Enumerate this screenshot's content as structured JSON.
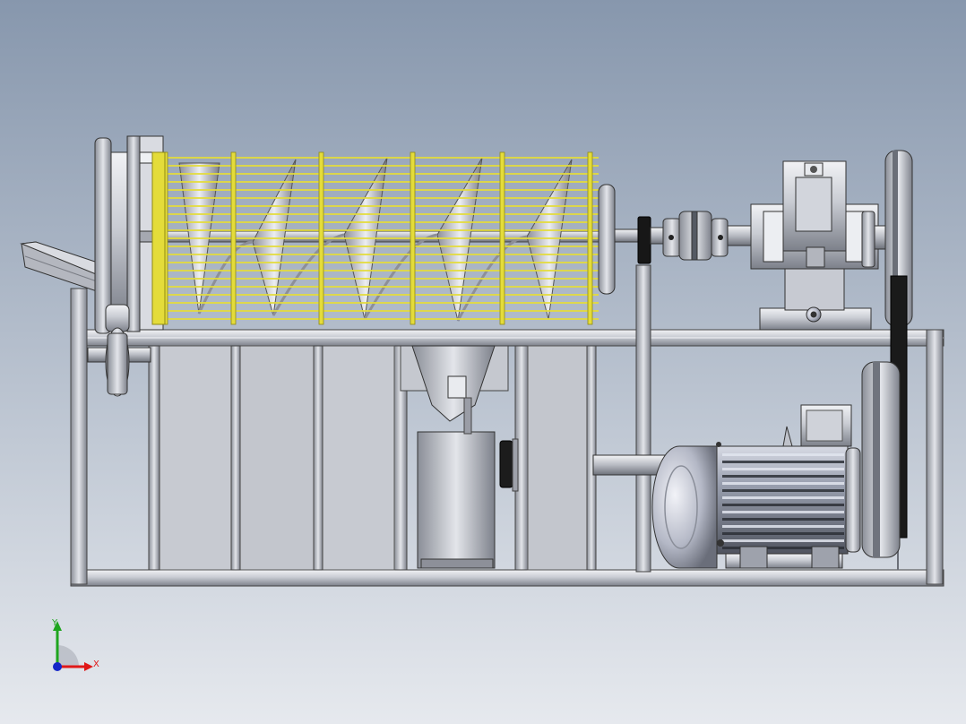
{
  "viewport": {
    "background_top": "#8797ad",
    "background_bottom": "#e6e9ee"
  },
  "colors": {
    "screen_mesh": "#e4dc3a",
    "screen_mesh_dark": "#8f8a12",
    "steel_light": "#dcdfe6",
    "steel_mid": "#a6aab4",
    "steel_dark": "#5b5f68",
    "rubber": "#151515"
  },
  "triad": {
    "x_label": "X",
    "y_label": "Y",
    "x_color": "#e01818",
    "y_color": "#1ea51e",
    "z_color": "#1426c8"
  },
  "icons": {
    "triad": "coordinate-triad-icon"
  }
}
